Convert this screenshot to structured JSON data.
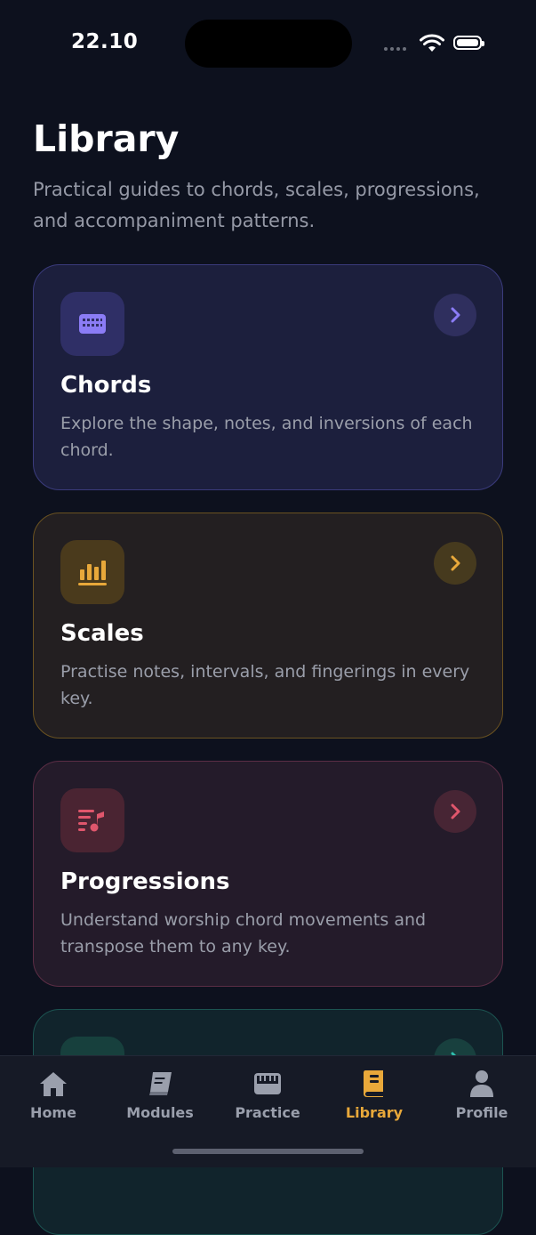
{
  "status_bar": {
    "time": "22.10"
  },
  "header": {
    "title": "Library",
    "subtitle": "Practical guides to chords, scales, progressions, and accompaniment patterns."
  },
  "cards": [
    {
      "title": "Chords",
      "description": "Explore the shape, notes, and inversions of each chord.",
      "icon": "keyboard-icon",
      "accent": "#8b7cf6"
    },
    {
      "title": "Scales",
      "description": "Practise notes, intervals, and fingerings in every key.",
      "icon": "bar-chart-icon",
      "accent": "#e8a83a"
    },
    {
      "title": "Progressions",
      "description": "Understand worship chord movements and transpose them to any key.",
      "icon": "music-list-icon",
      "accent": "#e0566c"
    },
    {
      "title": "",
      "description": "",
      "icon": "upload-icon",
      "accent": "#2fbfae"
    }
  ],
  "tabbar": {
    "items": [
      {
        "label": "Home",
        "icon": "house-icon",
        "active": false
      },
      {
        "label": "Modules",
        "icon": "book-icon",
        "active": false
      },
      {
        "label": "Practice",
        "icon": "piano-icon",
        "active": false
      },
      {
        "label": "Library",
        "icon": "library-book-icon",
        "active": true
      },
      {
        "label": "Profile",
        "icon": "person-icon",
        "active": false
      }
    ],
    "active_color": "#e8a83a"
  }
}
